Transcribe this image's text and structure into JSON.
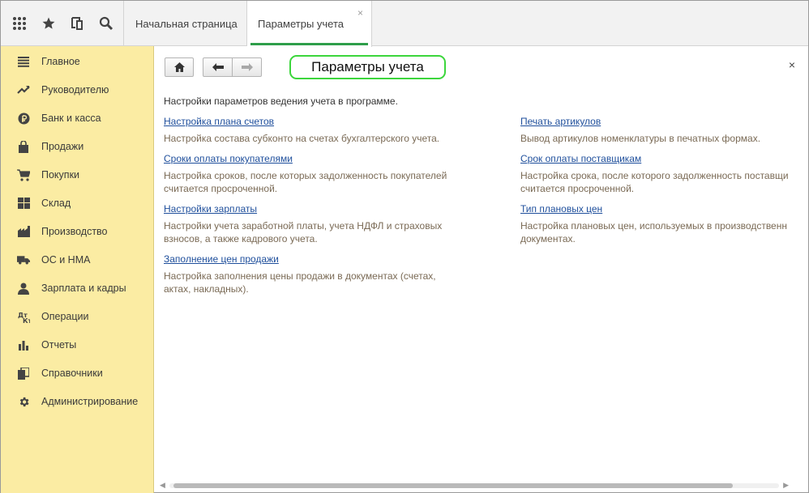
{
  "topbar": {
    "icons": [
      "apps-grid-icon",
      "star-icon",
      "history-icon",
      "search-icon"
    ],
    "tabs": [
      {
        "label": "Начальная страница"
      },
      {
        "label": "Параметры учета",
        "close": "×"
      }
    ]
  },
  "sidebar": {
    "items": [
      {
        "label": "Главное",
        "icon": "menu-lines-icon"
      },
      {
        "label": "Руководителю",
        "icon": "trend-icon"
      },
      {
        "label": "Банк и касса",
        "icon": "ruble-coin-icon"
      },
      {
        "label": "Продажи",
        "icon": "shopping-bag-icon"
      },
      {
        "label": "Покупки",
        "icon": "shopping-cart-icon"
      },
      {
        "label": "Склад",
        "icon": "warehouse-icon"
      },
      {
        "label": "Производство",
        "icon": "factory-icon"
      },
      {
        "label": "ОС и НМА",
        "icon": "truck-icon"
      },
      {
        "label": "Зарплата и кадры",
        "icon": "person-icon"
      },
      {
        "label": "Операции",
        "icon": "operations-icon"
      },
      {
        "label": "Отчеты",
        "icon": "bar-chart-icon"
      },
      {
        "label": "Справочники",
        "icon": "books-icon"
      },
      {
        "label": "Администрирование",
        "icon": "gear-icon"
      }
    ]
  },
  "main": {
    "title": "Параметры учета",
    "close": "×",
    "intro": "Настройки параметров ведения учета в программе.",
    "left": [
      {
        "link": "Настройка плана счетов",
        "desc": "Настройка состава субконто на счетах бухгалтерского учета."
      },
      {
        "link": "Сроки оплаты покупателями",
        "desc": "Настройка сроков, после которых задолженность покупателей\nсчитается просроченной."
      },
      {
        "link": "Настройки зарплаты",
        "desc": "Настройки учета заработной платы, учета НДФЛ и страховых\nвзносов, а также кадрового учета."
      },
      {
        "link": "Заполнение цен продажи",
        "desc": "Настройка заполнения цены продажи в документах (счетах,\nактах, накладных)."
      }
    ],
    "right": [
      {
        "link": "Печать артикулов",
        "desc": "Вывод артикулов номенклатуры в печатных формах."
      },
      {
        "link": "Срок оплаты поставщикам",
        "desc": "Настройка срока, после которого задолженность поставщи\nсчитается просроченной."
      },
      {
        "link": "Тип плановых цен",
        "desc": "Настройка плановых цен, используемых в производственн\nдокументах."
      }
    ]
  },
  "colors": {
    "sidebar_bg": "#fbeca3",
    "link": "#1f4f9c",
    "description": "#7a6a55",
    "title_highlight": "#3cd63c",
    "active_tab_underline": "#2e9e4a"
  }
}
